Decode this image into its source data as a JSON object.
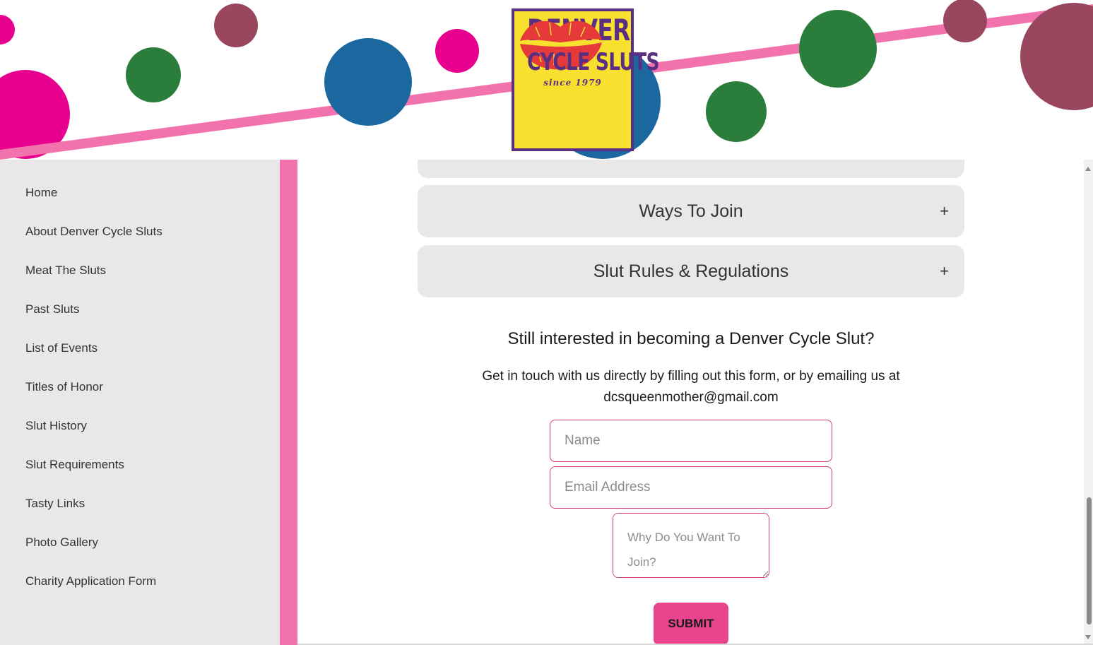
{
  "colors": {
    "accent_pink": "#f172ad",
    "hot_pink": "#e8008e",
    "green": "#2b7d3c",
    "blue": "#1b68a0",
    "plum": "#9a465e",
    "logo_yellow": "#f8e02e",
    "logo_purple": "#5a2f83",
    "lips_red": "#e63a3a",
    "button_pink": "#e8438c"
  },
  "logo": {
    "line1": "DENVER",
    "line2": "CYCLE SLUTS",
    "since": "since 1979",
    "lips_icon": "lips-kiss-icon"
  },
  "sidebar": {
    "items": [
      {
        "label": "Home"
      },
      {
        "label": "About Denver Cycle Sluts"
      },
      {
        "label": "Meat The Sluts"
      },
      {
        "label": "Past Sluts"
      },
      {
        "label": "List of Events"
      },
      {
        "label": "Titles of Honor"
      },
      {
        "label": "Slut History"
      },
      {
        "label": "Slut Requirements"
      },
      {
        "label": "Tasty Links"
      },
      {
        "label": "Photo Gallery"
      },
      {
        "label": "Charity Application Form"
      }
    ]
  },
  "accordion": {
    "sections": [
      {
        "title": "Ways To Join",
        "toggle": "+"
      },
      {
        "title": "Slut Rules & Regulations",
        "toggle": "+"
      }
    ]
  },
  "join": {
    "heading": "Still interested in becoming a Denver Cycle Slut?",
    "text": "Get in touch with us directly by filling out this form, or by emailing us at dcsqueenmother@gmail.com"
  },
  "form": {
    "name_placeholder": "Name",
    "email_placeholder": "Email Address",
    "why_placeholder": "Why Do You Want To Join?",
    "submit_label": "SUBMIT"
  }
}
